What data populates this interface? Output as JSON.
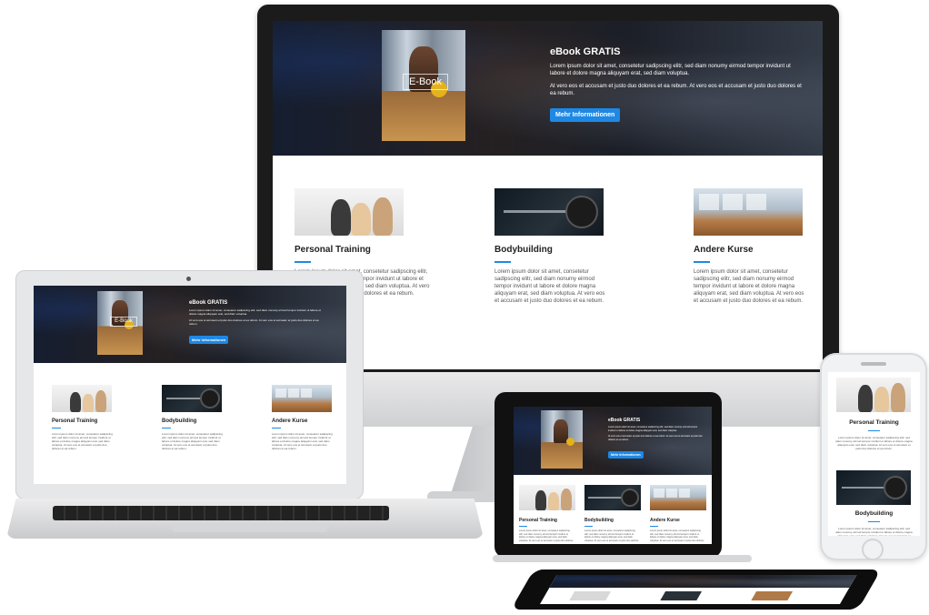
{
  "hero": {
    "ebook_label": "E-Book",
    "title": "eBook GRATIS",
    "paragraph1": "Lorem ipsum dolor sit amet, consetetur sadipscing elitr, sed diam nonumy eirmod tempor invidunt ut labore et dolore magna aliquyam erat, sed diam voluptua.",
    "paragraph2": "At vero eos et accusam et justo duo dolores et ea rebum. At vero eos et accusam et justo duo dolores et ea rebum.",
    "cta_label": "Mehr Informationen"
  },
  "cards": [
    {
      "title": "Personal Training",
      "text": "Lorem ipsum dolor sit amet, consetetur sadipscing elitr, sed diam nonumy eirmod tempor invidunt ut labore et dolore magna aliquyam erat, sed diam voluptua. At vero eos et accusam et justo duo dolores et ea rebum."
    },
    {
      "title": "Bodybuilding",
      "text": "Lorem ipsum dolor sit amet, consetetur sadipscing elitr, sed diam nonumy eirmod tempor invidunt ut labore et dolore magna aliquyam erat, sed diam voluptua. At vero eos et accusam et justo duo dolores et ea rebum."
    },
    {
      "title": "Andere Kurse",
      "text": "Lorem ipsum dolor sit amet, consetetur sadipscing elitr, sed diam nonumy eirmod tempor invidunt ut labore et dolore magna aliquyam erat, sed diam voluptua. At vero eos et accusam et justo duo dolores et ea rebum."
    }
  ],
  "colors": {
    "accent": "#1e88e5",
    "frame_dark": "#1b1b1b",
    "frame_light": "#e6e7e9"
  }
}
